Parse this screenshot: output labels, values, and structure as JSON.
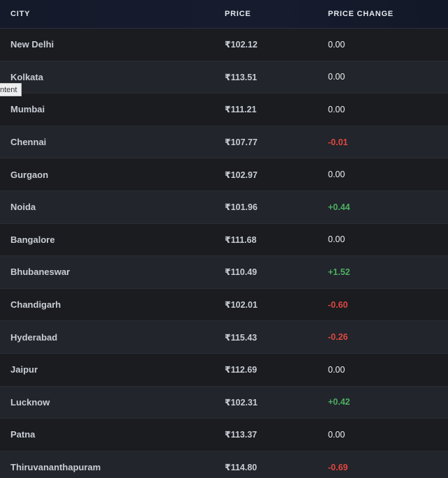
{
  "table": {
    "headers": {
      "city": "CITY",
      "price": "PRICE",
      "change": "PRICE CHANGE"
    },
    "rows": [
      {
        "city": "New Delhi",
        "price": "₹102.12",
        "change": "0.00",
        "trend": "neutral"
      },
      {
        "city": "Kolkata",
        "price": "₹113.51",
        "change": "0.00",
        "trend": "neutral"
      },
      {
        "city": "Mumbai",
        "price": "₹111.21",
        "change": "0.00",
        "trend": "neutral"
      },
      {
        "city": "Chennai",
        "price": "₹107.77",
        "change": "-0.01",
        "trend": "neg"
      },
      {
        "city": "Gurgaon",
        "price": "₹102.97",
        "change": "0.00",
        "trend": "neutral"
      },
      {
        "city": "Noida",
        "price": "₹101.96",
        "change": "+0.44",
        "trend": "pos"
      },
      {
        "city": "Bangalore",
        "price": "₹111.68",
        "change": "0.00",
        "trend": "neutral"
      },
      {
        "city": "Bhubaneswar",
        "price": "₹110.49",
        "change": "+1.52",
        "trend": "pos"
      },
      {
        "city": "Chandigarh",
        "price": "₹102.01",
        "change": "-0.60",
        "trend": "neg"
      },
      {
        "city": "Hyderabad",
        "price": "₹115.43",
        "change": "-0.26",
        "trend": "neg"
      },
      {
        "city": "Jaipur",
        "price": "₹112.69",
        "change": "0.00",
        "trend": "neutral"
      },
      {
        "city": "Lucknow",
        "price": "₹102.31",
        "change": "+0.42",
        "trend": "pos"
      },
      {
        "city": "Patna",
        "price": "₹113.37",
        "change": "0.00",
        "trend": "neutral"
      },
      {
        "city": "Thiruvananthapuram",
        "price": "₹114.80",
        "change": "-0.69",
        "trend": "neg"
      }
    ]
  },
  "tooltip": {
    "text": "ntent"
  },
  "colors": {
    "positive": "#4caf63",
    "negative": "#e0463f",
    "neutral": "#f2f2f2"
  }
}
